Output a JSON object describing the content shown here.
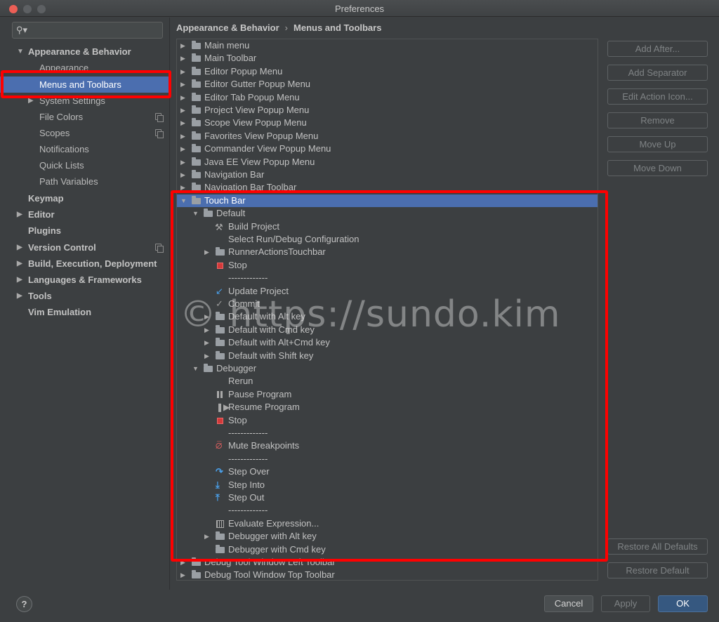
{
  "window": {
    "title": "Preferences"
  },
  "sidebar": {
    "items": [
      {
        "label": "Appearance & Behavior",
        "arrow": "▼"
      },
      {
        "label": "Appearance"
      },
      {
        "label": "Menus and Toolbars"
      },
      {
        "label": "System Settings",
        "arrow": "▶"
      },
      {
        "label": "File Colors"
      },
      {
        "label": "Scopes"
      },
      {
        "label": "Notifications"
      },
      {
        "label": "Quick Lists"
      },
      {
        "label": "Path Variables"
      },
      {
        "label": "Keymap"
      },
      {
        "label": "Editor",
        "arrow": "▶"
      },
      {
        "label": "Plugins"
      },
      {
        "label": "Version Control",
        "arrow": "▶"
      },
      {
        "label": "Build, Execution, Deployment",
        "arrow": "▶"
      },
      {
        "label": "Languages & Frameworks",
        "arrow": "▶"
      },
      {
        "label": "Tools",
        "arrow": "▶"
      },
      {
        "label": "Vim Emulation"
      }
    ]
  },
  "breadcrumb": {
    "parent": "Appearance & Behavior",
    "sep": "›",
    "current": "Menus and Toolbars"
  },
  "tree": [
    {
      "label": "Main menu"
    },
    {
      "label": "Main Toolbar"
    },
    {
      "label": "Editor Popup Menu"
    },
    {
      "label": "Editor Gutter Popup Menu"
    },
    {
      "label": "Editor Tab Popup Menu"
    },
    {
      "label": "Project View Popup Menu"
    },
    {
      "label": "Scope View Popup Menu"
    },
    {
      "label": "Favorites View Popup Menu"
    },
    {
      "label": "Commander View Popup Menu"
    },
    {
      "label": "Java EE View Popup Menu"
    },
    {
      "label": "Navigation Bar"
    },
    {
      "label": "Navigation Bar Toolbar"
    },
    {
      "label": "Touch Bar"
    },
    {
      "label": "Default"
    },
    {
      "label": "Build Project"
    },
    {
      "label": "Select Run/Debug Configuration"
    },
    {
      "label": "RunnerActionsTouchbar"
    },
    {
      "label": "Stop"
    },
    {
      "label": "-------------"
    },
    {
      "label": "Update Project"
    },
    {
      "label": "Commit"
    },
    {
      "label": "Default with Alt key"
    },
    {
      "label": "Default with Cmd key"
    },
    {
      "label": "Default with Alt+Cmd key"
    },
    {
      "label": "Default with Shift key"
    },
    {
      "label": "Debugger"
    },
    {
      "label": "Rerun"
    },
    {
      "label": "Pause Program"
    },
    {
      "label": "Resume Program"
    },
    {
      "label": "Stop"
    },
    {
      "label": "-------------"
    },
    {
      "label": "Mute Breakpoints"
    },
    {
      "label": "-------------"
    },
    {
      "label": "Step Over"
    },
    {
      "label": "Step Into"
    },
    {
      "label": "Step Out"
    },
    {
      "label": "-------------"
    },
    {
      "label": "Evaluate Expression..."
    },
    {
      "label": "Debugger with Alt key"
    },
    {
      "label": "Debugger with Cmd key"
    },
    {
      "label": "Debug Tool Window Left Toolbar"
    },
    {
      "label": "Debug Tool Window Top Toolbar"
    }
  ],
  "arrows": {
    "collapsed": "▶",
    "expanded": "▼"
  },
  "watermark": "© https://sundo.kim",
  "actions": {
    "add_after": "Add After...",
    "add_separator": "Add Separator",
    "edit_icon": "Edit Action Icon...",
    "remove": "Remove",
    "move_up": "Move Up",
    "move_down": "Move Down",
    "restore_all": "Restore All Defaults",
    "restore_default": "Restore Default"
  },
  "footer": {
    "help": "?",
    "cancel": "Cancel",
    "apply": "Apply",
    "ok": "OK"
  },
  "colors": {
    "selection": "#4b6eaf",
    "highlight_box": "#ff0000",
    "ok_button": "#365880"
  }
}
